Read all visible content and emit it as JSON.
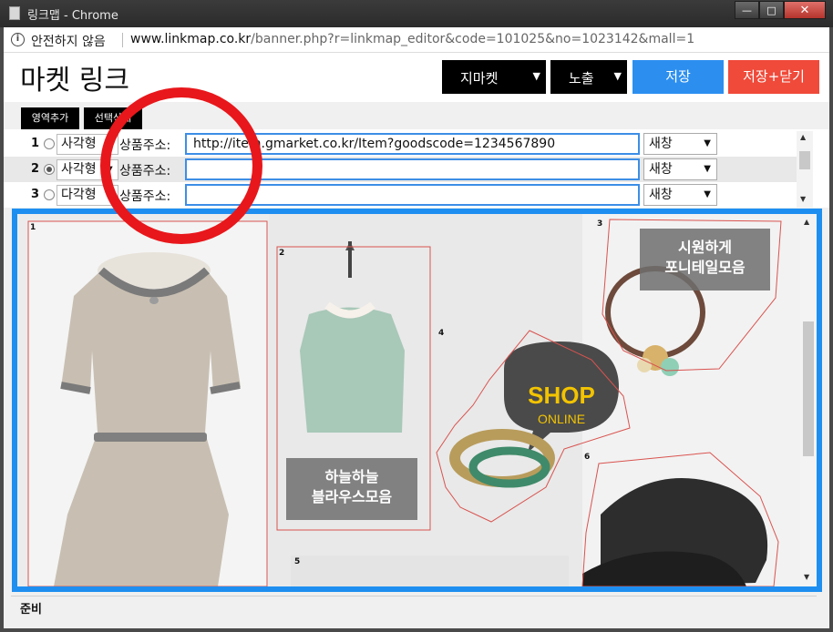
{
  "window": {
    "title": "링크맵 - Chrome",
    "controls": {
      "minimize": "—",
      "maximize": "□",
      "close": "✕"
    }
  },
  "address_bar": {
    "security_text": "안전하지 않음",
    "url_host": "www.linkmap.co.kr",
    "url_path": "/banner.php?r=linkmap_editor&code=101025&no=1023142&mall=1"
  },
  "header": {
    "title": "마켓 링크",
    "market_select": "지마켓",
    "visibility_select": "노출",
    "save_label": "저장",
    "save_close_label": "저장+닫기"
  },
  "toolbar": {
    "add_area_label": "영역추가",
    "delete_selected_label": "선택삭제"
  },
  "link_rows": [
    {
      "num": "1",
      "selected": false,
      "shape": "사각형",
      "addr_label": "상품주소:",
      "addr_value": "http://item.gmarket.co.kr/Item?goodscode=1234567890",
      "target": "새창"
    },
    {
      "num": "2",
      "selected": true,
      "shape": "사각형",
      "addr_label": "상품주소:",
      "addr_value": "",
      "target": "새창"
    },
    {
      "num": "3",
      "selected": false,
      "shape": "다각형",
      "addr_label": "상품주소:",
      "addr_value": "",
      "target": "새창"
    }
  ],
  "canvas": {
    "areas": [
      "1",
      "2",
      "3",
      "4",
      "5",
      "6"
    ],
    "overlay_blouse": [
      "하늘하늘",
      "블라우스모음"
    ],
    "overlay_ponytail": [
      "시원하게",
      "포니테일모음"
    ],
    "shop_bubble": {
      "line1": "SHOP",
      "line2": "ONLINE"
    }
  },
  "status": {
    "text": "준비"
  },
  "colors": {
    "accent_blue": "#2c8ff0",
    "accent_red": "#ef4a3a",
    "annotation_red": "#e8171b",
    "canvas_border": "#1e8ff0"
  }
}
